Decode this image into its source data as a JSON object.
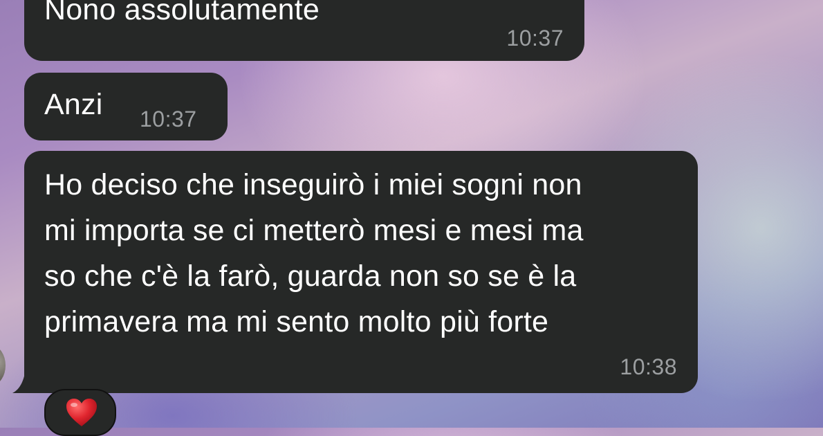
{
  "messages": [
    {
      "text": "Nono assolutamente",
      "time": "10:37"
    },
    {
      "text": "Anzi",
      "time": "10:37"
    },
    {
      "text": "Ho deciso che inseguirò i miei sogni non\nmi importa se ci metterò mesi e mesi ma\nso che c'è la farò, guarda non so se è la\nprimavera ma mi sento molto più forte",
      "time": "10:38"
    }
  ],
  "reaction": {
    "emoji_name": "red-heart-icon"
  },
  "colors": {
    "bubble_background": "#262827",
    "message_text": "#ffffff",
    "timestamp_text": "#9c9fa1",
    "heart": "#e0252e"
  }
}
